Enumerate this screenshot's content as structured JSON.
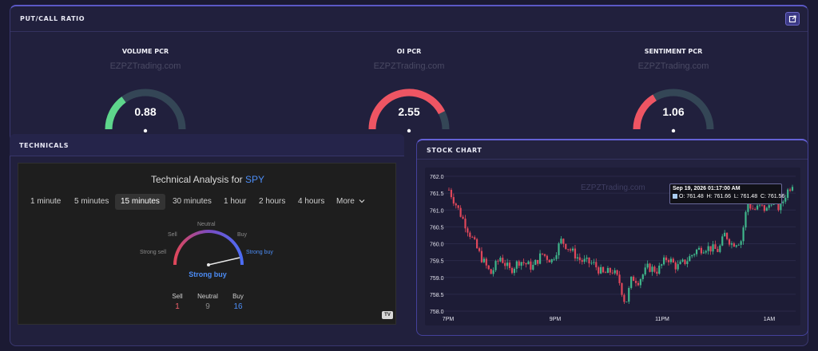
{
  "pcr": {
    "title": "PUT/CALL RATIO",
    "watermark": "EZPZTrading.com",
    "gauges": [
      {
        "title": "VOLUME PCR",
        "value": "0.88",
        "fill_fraction": 0.3,
        "color": "#5ed68c"
      },
      {
        "title": "OI PCR",
        "value": "2.55",
        "fill_fraction": 0.85,
        "color": "#ee5563"
      },
      {
        "title": "SENTIMENT PCR",
        "value": "1.06",
        "fill_fraction": 0.33,
        "color": "#ee5563"
      }
    ],
    "track_color": "#344656"
  },
  "technicals": {
    "title": "TECHNICALS",
    "widget": {
      "title_prefix": "Technical Analysis for",
      "symbol": "SPY",
      "tabs": [
        "1 minute",
        "5 minutes",
        "15 minutes",
        "30 minutes",
        "1 hour",
        "2 hours",
        "4 hours",
        "More"
      ],
      "active_tab": "15 minutes",
      "gauge_labels": {
        "strong_sell": "Strong sell",
        "sell": "Sell",
        "neutral": "Neutral",
        "buy": "Buy",
        "strong_buy": "Strong buy"
      },
      "verdict": "Strong buy",
      "counts": [
        {
          "label": "Sell",
          "value": "1",
          "color": "#f0606b"
        },
        {
          "label": "Neutral",
          "value": "9",
          "color": "#8c8c8c"
        },
        {
          "label": "Buy",
          "value": "16",
          "color": "#4c8df6"
        }
      ],
      "logo": "TV"
    }
  },
  "stock_chart": {
    "title": "STOCK CHART",
    "watermark": "EZPZTrading.com",
    "tooltip": {
      "date": "Sep 19, 2026 01:17:00 AM",
      "open": "O: 761.48",
      "high": "H: 761.66",
      "low": "L: 761.48",
      "close": "C: 761.56"
    }
  },
  "chart_data": {
    "type": "candlestick",
    "title": "",
    "xlabel": "",
    "ylabel": "",
    "x_ticks": [
      "7PM",
      "9PM",
      "11PM",
      "1AM"
    ],
    "y_ticks": [
      "762.0",
      "761.5",
      "761.0",
      "760.5",
      "760.0",
      "759.5",
      "759.0",
      "758.5",
      "758.0"
    ],
    "ylim": [
      758.0,
      762.0
    ],
    "up_color": "#3fb68b",
    "down_color": "#e0475a",
    "close_anchors": [
      [
        0,
        761.6
      ],
      [
        3,
        761.0
      ],
      [
        7,
        760.2
      ],
      [
        10,
        759.6
      ],
      [
        13,
        759.1
      ],
      [
        16,
        759.6
      ],
      [
        19,
        759.2
      ],
      [
        22,
        759.5
      ],
      [
        26,
        759.3
      ],
      [
        29,
        759.7
      ],
      [
        32,
        759.5
      ],
      [
        35,
        760.1
      ],
      [
        38,
        759.8
      ],
      [
        41,
        759.5
      ],
      [
        45,
        759.4
      ],
      [
        48,
        759.1
      ],
      [
        51,
        759.2
      ],
      [
        53,
        758.9
      ],
      [
        55,
        758.2
      ],
      [
        57,
        759.0
      ],
      [
        59,
        758.9
      ],
      [
        62,
        759.3
      ],
      [
        65,
        759.2
      ],
      [
        68,
        759.6
      ],
      [
        71,
        759.3
      ],
      [
        74,
        759.5
      ],
      [
        77,
        759.8
      ],
      [
        80,
        759.9
      ],
      [
        84,
        759.8
      ],
      [
        86,
        760.3
      ],
      [
        88,
        760.0
      ],
      [
        91,
        760.1
      ],
      [
        93,
        761.2
      ],
      [
        95,
        761.0
      ],
      [
        97,
        761.1
      ],
      [
        99,
        761.0
      ],
      [
        101,
        761.4
      ],
      [
        103,
        761.0
      ],
      [
        105,
        761.5
      ],
      [
        107,
        761.8
      ]
    ]
  }
}
